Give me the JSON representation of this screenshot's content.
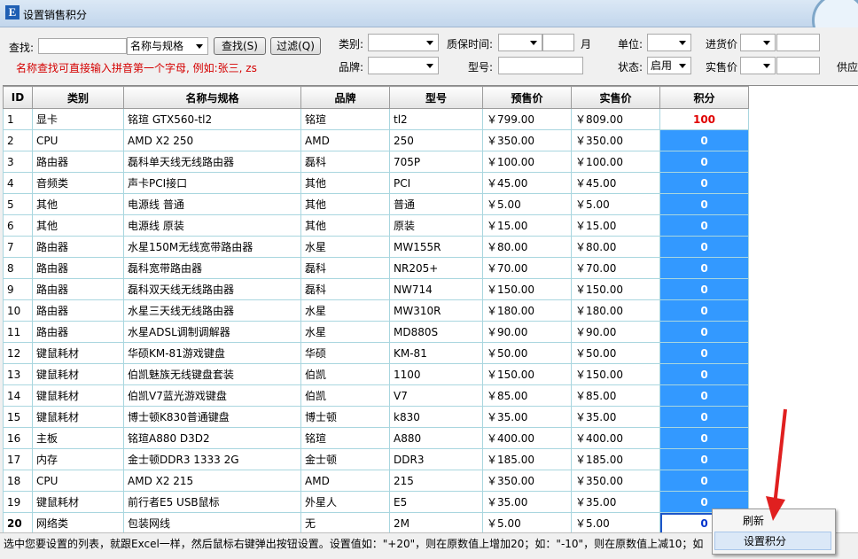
{
  "window": {
    "title": "设置销售积分",
    "icon": "E"
  },
  "filters": {
    "search_label": "查找:",
    "search_value": "",
    "search_mode": "名称与规格",
    "find_button": "查找(S)",
    "filter_button": "过滤(Q)",
    "hint": "名称查找可直接输入拼音第一个字母, 例如:张三, zs",
    "category_label": "类别:",
    "category_value": "",
    "warranty_label": "质保时间:",
    "warranty_value": "",
    "month_label": "月",
    "unit_label": "单位:",
    "unit_value": "",
    "purchase_price_label": "进货价",
    "brand_label": "品牌:",
    "brand_value": "",
    "model_label": "型号:",
    "model_value": "",
    "status_label": "状态:",
    "status_value": "启用",
    "actual_price_label": "实售价",
    "supplier_label": "供应"
  },
  "table": {
    "columns": [
      "ID",
      "类别",
      "名称与规格",
      "品牌",
      "型号",
      "预售价",
      "实售价",
      "积分"
    ],
    "rows": [
      [
        "1",
        "显卡",
        "铭瑄 GTX560-tl2",
        "铭瑄",
        "tl2",
        "￥799.00",
        "￥809.00",
        "100"
      ],
      [
        "2",
        "CPU",
        "AMD X2 250",
        "AMD",
        "250",
        "￥350.00",
        "￥350.00",
        "0"
      ],
      [
        "3",
        "路由器",
        "磊科单天线无线路由器",
        "磊科",
        "705P",
        "￥100.00",
        "￥100.00",
        "0"
      ],
      [
        "4",
        "音频类",
        "声卡PCI接口",
        "其他",
        "PCI",
        "￥45.00",
        "￥45.00",
        "0"
      ],
      [
        "5",
        "其他",
        "电源线 普通",
        "其他",
        "普通",
        "￥5.00",
        "￥5.00",
        "0"
      ],
      [
        "6",
        "其他",
        "电源线 原装",
        "其他",
        "原装",
        "￥15.00",
        "￥15.00",
        "0"
      ],
      [
        "7",
        "路由器",
        "水星150M无线宽带路由器",
        "水星",
        "MW155R",
        "￥80.00",
        "￥80.00",
        "0"
      ],
      [
        "8",
        "路由器",
        "磊科宽带路由器",
        "磊科",
        "NR205+",
        "￥70.00",
        "￥70.00",
        "0"
      ],
      [
        "9",
        "路由器",
        "磊科双天线无线路由器",
        "磊科",
        "NW714",
        "￥150.00",
        "￥150.00",
        "0"
      ],
      [
        "10",
        "路由器",
        "水星三天线无线路由器",
        "水星",
        "MW310R",
        "￥180.00",
        "￥180.00",
        "0"
      ],
      [
        "11",
        "路由器",
        "水星ADSL调制调解器",
        "水星",
        "MD880S",
        "￥90.00",
        "￥90.00",
        "0"
      ],
      [
        "12",
        "键鼠耗材",
        "华硕KM-81游戏键盘",
        "华硕",
        "KM-81",
        "￥50.00",
        "￥50.00",
        "0"
      ],
      [
        "13",
        "键鼠耗材",
        "伯凯魅族无线键盘套装",
        "伯凯",
        "1100",
        "￥150.00",
        "￥150.00",
        "0"
      ],
      [
        "14",
        "键鼠耗材",
        "伯凯V7蓝光游戏键盘",
        "伯凯",
        "V7",
        "￥85.00",
        "￥85.00",
        "0"
      ],
      [
        "15",
        "键鼠耗材",
        "博士顿K830普通键盘",
        "博士顿",
        "k830",
        "￥35.00",
        "￥35.00",
        "0"
      ],
      [
        "16",
        "主板",
        "铭瑄A880 D3D2",
        "铭瑄",
        "A880",
        "￥400.00",
        "￥400.00",
        "0"
      ],
      [
        "17",
        "内存",
        "金士顿DDR3 1333 2G",
        "金士顿",
        "DDR3",
        "￥185.00",
        "￥185.00",
        "0"
      ],
      [
        "18",
        "CPU",
        "AMD X2 215",
        "AMD",
        "215",
        "￥350.00",
        "￥350.00",
        "0"
      ],
      [
        "19",
        "键鼠耗材",
        "前行者E5 USB鼠标",
        "外星人",
        "E5",
        "￥35.00",
        "￥35.00",
        "0"
      ],
      [
        "20",
        "网络类",
        "包装网线",
        "无",
        "2M",
        "￥5.00",
        "￥5.00",
        "0"
      ]
    ]
  },
  "status_bar": "选中您要设置的列表，就跟Excel一样，然后鼠标右键弹出按钮设置。设置值如：\"+20\"，则在原数值上增加20；如：\"-10\"，则在原数值上减10；如",
  "context_menu": {
    "items": [
      "刷新",
      "设置积分"
    ],
    "highlighted": "设置积分"
  },
  "colors": {
    "selection": "#3399ff",
    "points_highlight": "#e00000",
    "hint": "#d40000",
    "arrow": "#e02020"
  }
}
